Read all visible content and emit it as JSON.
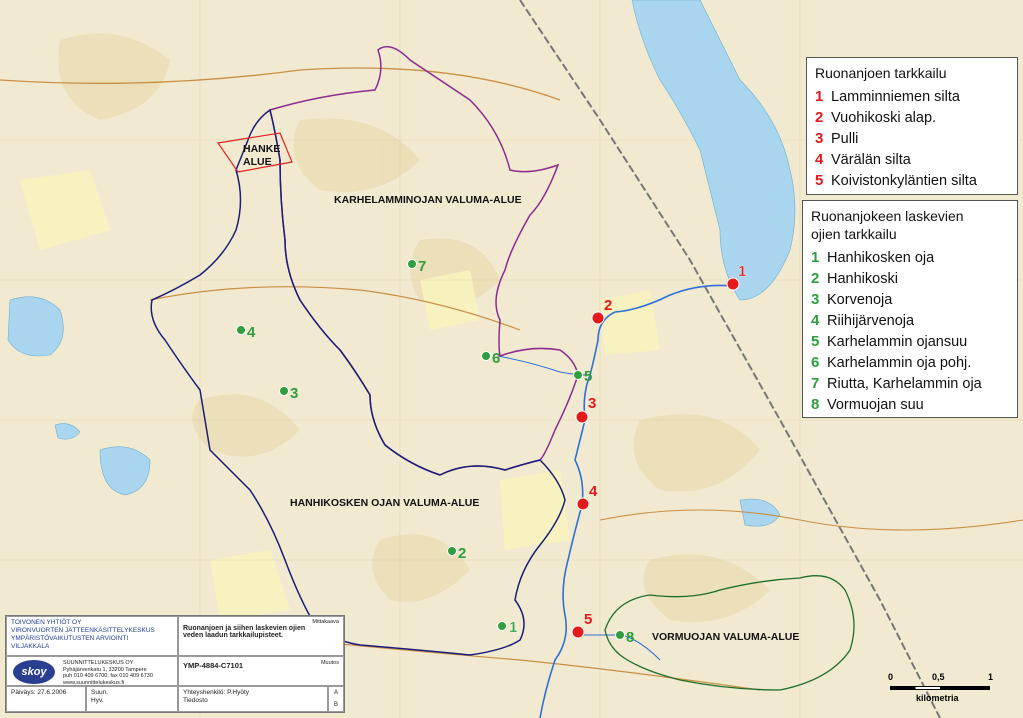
{
  "map_labels": {
    "hanke_alue_line1": "HANKE",
    "hanke_alue_line2": "ALUE",
    "karhelamminojan": "KARHELAMMINOJAN VALUMA-ALUE",
    "hanhikosken": "HANHIKOSKEN OJAN VALUMA-ALUE",
    "vormuojan": "VORMUOJAN VALUMA-ALUE"
  },
  "river_points": [
    {
      "num": "1",
      "label": "Lamminniemen silta"
    },
    {
      "num": "2",
      "label": "Vuohikoski alap."
    },
    {
      "num": "3",
      "label": "Pulli"
    },
    {
      "num": "4",
      "label": "Värälän silta"
    },
    {
      "num": "5",
      "label": "Koivistonkyläntien silta"
    }
  ],
  "ditch_points": [
    {
      "num": "1",
      "label": "Hanhikosken oja"
    },
    {
      "num": "2",
      "label": "Hanhikoski"
    },
    {
      "num": "3",
      "label": "Korvenoja"
    },
    {
      "num": "4",
      "label": "Riihijärvenoja"
    },
    {
      "num": "5",
      "label": "Karhelammin ojansuu"
    },
    {
      "num": "6",
      "label": "Karhelammin oja pohj."
    },
    {
      "num": "7",
      "label": "Riutta, Karhelammin oja"
    },
    {
      "num": "8",
      "label": "Vormuojan suu"
    }
  ],
  "legend": {
    "river_title": "Ruonanjoen tarkkailu",
    "ditch_title_line1": "Ruonanjokeen laskevien",
    "ditch_title_line2": "ojien tarkkailu"
  },
  "title_block": {
    "company_line1": "TOIVONEN YHTIÖT OY",
    "company_line2": "VIRONVUORTEN JÄTTEENKÄSITTELYKESKUS",
    "company_line3": "YMPÄRISTÖVAIKUTUSTEN ARVIOINTI",
    "company_line4": "VILJAKKALA",
    "mittakaava": "Mittakaava",
    "map_title_line1": "Ruonanjoen ja siihen laskevien ojien",
    "map_title_line2": "veden laadun tarkkailupisteet.",
    "logo_text": "skoy",
    "firm_name": "SUUNNITTELUKESKUS OY",
    "firm_addr": "Pyhäjärvenkatu 1, 33200 Tampere",
    "firm_phone": "puh 010 409 6700, fax 010 409 6730",
    "firm_web": "www.suunnittelukeskus.fi",
    "drawing_no": "YMP-4884-C7101",
    "muutos": "Muutos",
    "paivays": "Päiväys: 27.6.2006",
    "suun": "Suun.",
    "hyv": "Hyv.",
    "yhteyshenkilo": "Yhteyshenkilö: P.Hyöty",
    "tiedosto": "Tiedosto",
    "rev_a": "A",
    "rev_b": "B"
  },
  "scale_bar": {
    "tick_0": "0",
    "tick_mid": "0,5",
    "tick_1": "1",
    "unit": "kilometria"
  },
  "colors": {
    "river_point": "#e41a1a",
    "ditch_point": "#2e9e3e",
    "water": "#a9d6ee",
    "river_line": "#2f6fd6",
    "karhelammi_boundary": "#8b2a8f",
    "hanhikoski_boundary": "#1c1c7a",
    "vormuoja_boundary": "#1e6e2a",
    "hanke_boundary": "#e02020"
  }
}
